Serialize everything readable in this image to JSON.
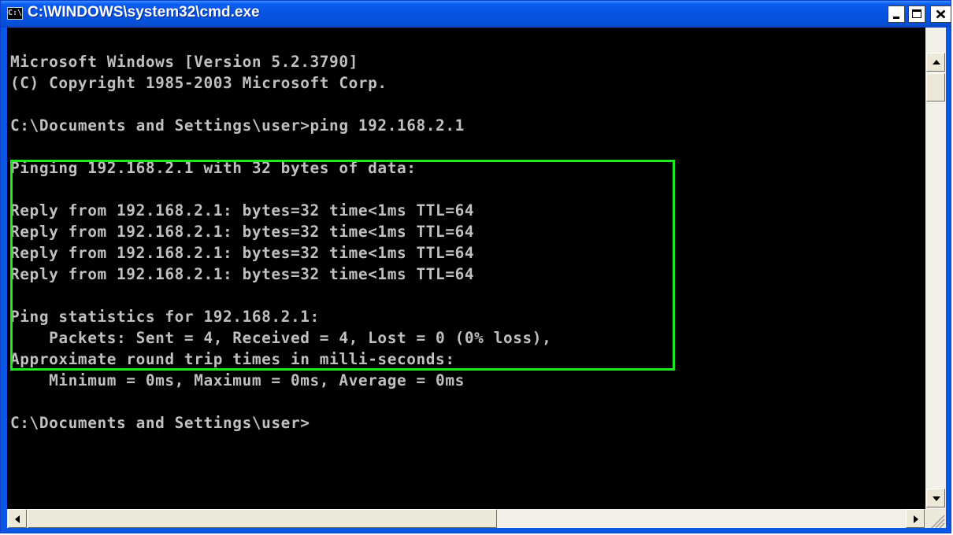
{
  "window": {
    "title": "C:\\WINDOWS\\system32\\cmd.exe",
    "icon_text": "C:\\"
  },
  "console": {
    "text_color": "#c0c0c0",
    "background_color": "#000000",
    "lines": [
      "Microsoft Windows [Version 5.2.3790]",
      "(C) Copyright 1985-2003 Microsoft Corp.",
      "",
      "C:\\Documents and Settings\\user>ping 192.168.2.1",
      "",
      "Pinging 192.168.2.1 with 32 bytes of data:",
      "",
      "Reply from 192.168.2.1: bytes=32 time<1ms TTL=64",
      "Reply from 192.168.2.1: bytes=32 time<1ms TTL=64",
      "Reply from 192.168.2.1: bytes=32 time<1ms TTL=64",
      "Reply from 192.168.2.1: bytes=32 time<1ms TTL=64",
      "",
      "Ping statistics for 192.168.2.1:",
      "    Packets: Sent = 4, Received = 4, Lost = 0 (0% loss),",
      "Approximate round trip times in milli-seconds:",
      "    Minimum = 0ms, Maximum = 0ms, Average = 0ms",
      "",
      "C:\\Documents and Settings\\user>"
    ]
  },
  "highlight": {
    "color": "#1ee81e"
  },
  "icons": {
    "app": "cmd-icon",
    "minimize": "minimize-icon",
    "maximize": "maximize-icon",
    "close": "close-icon",
    "scroll_up": "arrow-up-icon",
    "scroll_down": "arrow-down-icon",
    "scroll_left": "arrow-left-icon",
    "scroll_right": "arrow-right-icon",
    "size_grip": "size-grip-icon"
  }
}
